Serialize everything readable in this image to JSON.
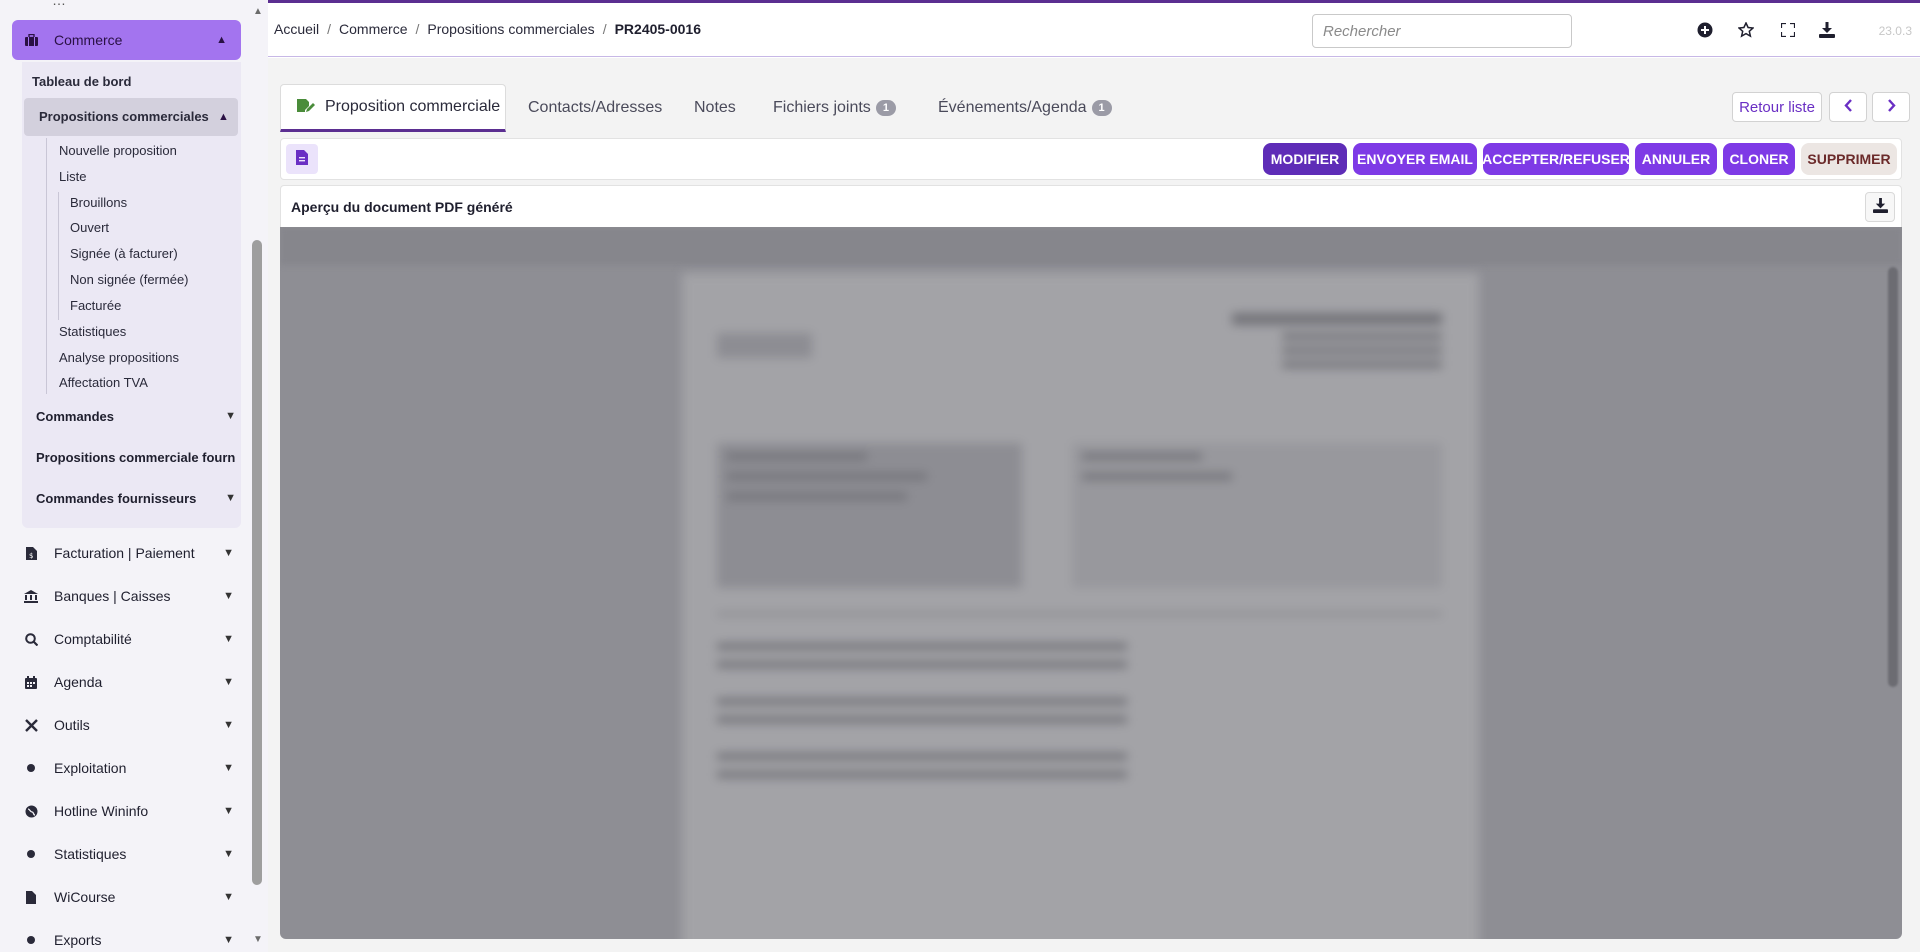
{
  "sidebar": {
    "commerce_label": "Commerce",
    "dashboard_label": "Tableau de bord",
    "propositions_label": "Propositions commerciales",
    "prop_items": [
      {
        "label": "Nouvelle proposition"
      },
      {
        "label": "Liste"
      },
      {
        "label": "Brouillons"
      },
      {
        "label": "Ouvert"
      },
      {
        "label": "Signée (à facturer)"
      },
      {
        "label": "Non signée (fermée)"
      },
      {
        "label": "Facturée"
      },
      {
        "label": "Statistiques"
      },
      {
        "label": "Analyse propositions"
      },
      {
        "label": "Affectation TVA"
      }
    ],
    "sub_groups": [
      {
        "label": "Commandes"
      },
      {
        "label": "Propositions commerciale fourni"
      },
      {
        "label": "Commandes fournisseurs"
      }
    ],
    "main_items": [
      {
        "label": "Facturation | Paiement",
        "icon": "invoice-icon"
      },
      {
        "label": "Banques | Caisses",
        "icon": "bank-icon"
      },
      {
        "label": "Comptabilité",
        "icon": "search-dollar-icon"
      },
      {
        "label": "Agenda",
        "icon": "calendar-icon"
      },
      {
        "label": "Outils",
        "icon": "tools-icon"
      },
      {
        "label": "Exploitation",
        "icon": "dot-icon"
      },
      {
        "label": "Hotline Wininfo",
        "icon": "globe-icon"
      },
      {
        "label": "Statistiques",
        "icon": "dot-icon"
      },
      {
        "label": "WiCourse",
        "icon": "file-icon"
      },
      {
        "label": "Exports",
        "icon": "dot-icon"
      }
    ]
  },
  "topbar": {
    "breadcrumb": [
      "Accueil",
      "Commerce",
      "Propositions commerciales",
      "PR2405-0016"
    ],
    "search_placeholder": "Rechercher",
    "version": "23.0.3"
  },
  "tabs": [
    {
      "label": "Proposition commerciale"
    },
    {
      "label": "Contacts/Adresses"
    },
    {
      "label": "Notes"
    },
    {
      "label": "Fichiers joints",
      "badge": "1"
    },
    {
      "label": "Événements/Agenda",
      "badge": "1"
    }
  ],
  "nav": {
    "back_label": "Retour liste"
  },
  "actions": {
    "modify": "MODIFIER",
    "send_email": "ENVOYER EMAIL",
    "accept_refuse": "ACCEPTER/REFUSER",
    "cancel": "ANNULER",
    "clone": "CLONER",
    "delete": "SUPPRIMER"
  },
  "pdf": {
    "title": "Aperçu du document PDF généré"
  },
  "colors": {
    "brand": "#5b2e91",
    "accent": "#7e3ae6",
    "sidebar_active": "#a374ef"
  }
}
